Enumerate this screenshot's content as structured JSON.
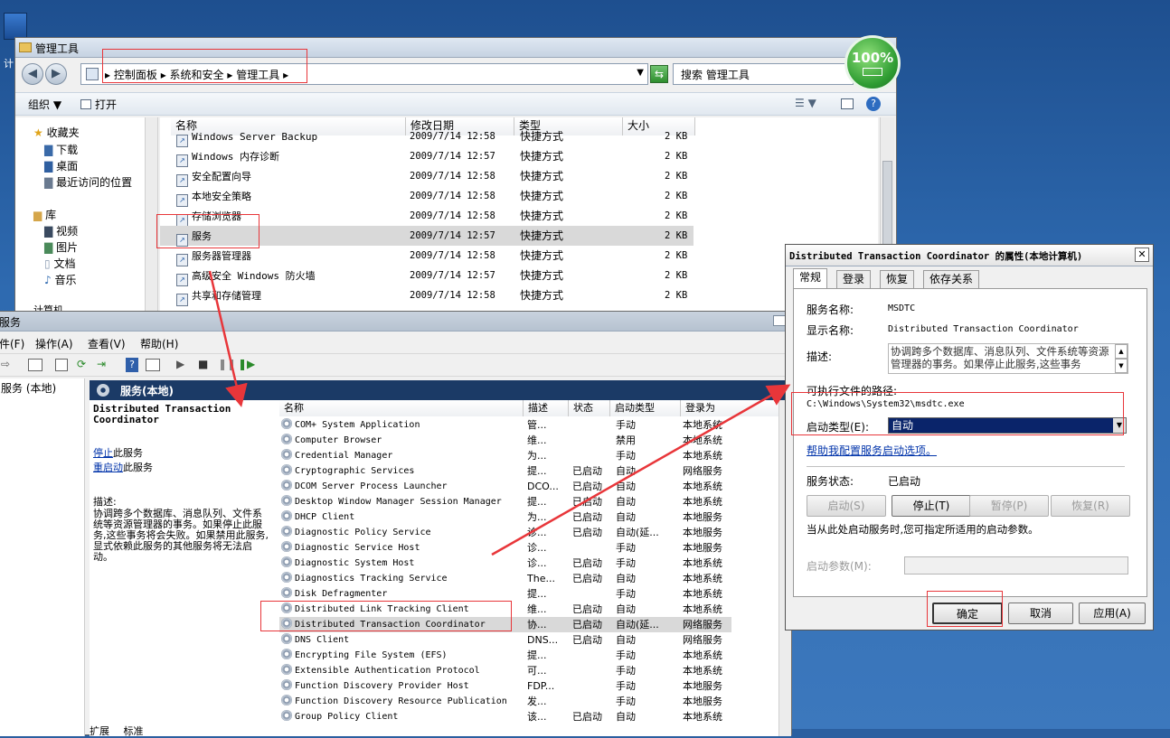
{
  "colors": {
    "red_annotation": "#e8363a",
    "title_dark": "#1b3a66",
    "selection": "#0a246a"
  },
  "desktop": {
    "icon_label": "计"
  },
  "explorer": {
    "title": "管理工具",
    "breadcrumb": [
      "控制面板",
      "系统和安全",
      "管理工具"
    ],
    "search_placeholder": "搜索 管理工具",
    "toolbar": {
      "organize": "组织",
      "open": "打开"
    },
    "nav": {
      "favorites": "收藏夹",
      "downloads": "下载",
      "desktop": "桌面",
      "recent": "最近访问的位置",
      "library": "库",
      "videos": "视频",
      "pictures": "图片",
      "documents": "文档",
      "music": "音乐",
      "computer": "计算机"
    },
    "columns": [
      "名称",
      "修改日期",
      "类型",
      "大小"
    ],
    "files": [
      {
        "name": "Windows Server Backup",
        "date": "2009/7/14 12:58",
        "type": "快捷方式",
        "size": "2 KB"
      },
      {
        "name": "Windows 内存诊断",
        "date": "2009/7/14 12:57",
        "type": "快捷方式",
        "size": "2 KB"
      },
      {
        "name": "安全配置向导",
        "date": "2009/7/14 12:58",
        "type": "快捷方式",
        "size": "2 KB"
      },
      {
        "name": "本地安全策略",
        "date": "2009/7/14 12:58",
        "type": "快捷方式",
        "size": "2 KB"
      },
      {
        "name": "存储浏览器",
        "date": "2009/7/14 12:58",
        "type": "快捷方式",
        "size": "2 KB"
      },
      {
        "name": "服务",
        "date": "2009/7/14 12:57",
        "type": "快捷方式",
        "size": "2 KB"
      },
      {
        "name": "服务器管理器",
        "date": "2009/7/14 12:58",
        "type": "快捷方式",
        "size": "2 KB"
      },
      {
        "name": "高级安全 Windows 防火墙",
        "date": "2009/7/14 12:57",
        "type": "快捷方式",
        "size": "2 KB"
      },
      {
        "name": "共享和存储管理",
        "date": "2009/7/14 12:58",
        "type": "快捷方式",
        "size": "2 KB"
      }
    ]
  },
  "badge": {
    "percent": "100%"
  },
  "services": {
    "title": "服务",
    "menu": [
      "件(F)",
      "操作(A)",
      "查看(V)",
      "帮助(H)"
    ],
    "tree_item": "服务 (本地)",
    "panel_title": "服务(本地)",
    "detail": {
      "name": "Distributed Transaction Coordinator",
      "stop_link": "停止",
      "stop_suffix": "此服务",
      "restart_link": "重启动",
      "restart_suffix": "此服务",
      "desc_label": "描述:",
      "desc": "协调跨多个数据库、消息队列、文件系统等资源管理器的事务。如果停止此服务,这些事务将会失败。如果禁用此服务,显式依赖此服务的其他服务将无法启动。"
    },
    "columns": [
      "名称",
      "描述",
      "状态",
      "启动类型",
      "登录为"
    ],
    "rows": [
      {
        "name": "COM+ System Application",
        "desc": "管...",
        "status": "",
        "startup": "手动",
        "logon": "本地系统"
      },
      {
        "name": "Computer Browser",
        "desc": "维...",
        "status": "",
        "startup": "禁用",
        "logon": "本地系统"
      },
      {
        "name": "Credential Manager",
        "desc": "为...",
        "status": "",
        "startup": "手动",
        "logon": "本地系统"
      },
      {
        "name": "Cryptographic Services",
        "desc": "提...",
        "status": "已启动",
        "startup": "自动",
        "logon": "网络服务"
      },
      {
        "name": "DCOM Server Process Launcher",
        "desc": "DCO...",
        "status": "已启动",
        "startup": "自动",
        "logon": "本地系统"
      },
      {
        "name": "Desktop Window Manager Session Manager",
        "desc": "提...",
        "status": "已启动",
        "startup": "自动",
        "logon": "本地系统"
      },
      {
        "name": "DHCP Client",
        "desc": "为...",
        "status": "已启动",
        "startup": "自动",
        "logon": "本地服务"
      },
      {
        "name": "Diagnostic Policy Service",
        "desc": "诊...",
        "status": "已启动",
        "startup": "自动(延...",
        "logon": "本地服务"
      },
      {
        "name": "Diagnostic Service Host",
        "desc": "诊...",
        "status": "",
        "startup": "手动",
        "logon": "本地服务"
      },
      {
        "name": "Diagnostic System Host",
        "desc": "诊...",
        "status": "已启动",
        "startup": "手动",
        "logon": "本地系统"
      },
      {
        "name": "Diagnostics Tracking Service",
        "desc": "The...",
        "status": "已启动",
        "startup": "自动",
        "logon": "本地系统"
      },
      {
        "name": "Disk Defragmenter",
        "desc": "提...",
        "status": "",
        "startup": "手动",
        "logon": "本地系统"
      },
      {
        "name": "Distributed Link Tracking Client",
        "desc": "维...",
        "status": "已启动",
        "startup": "自动",
        "logon": "本地系统"
      },
      {
        "name": "Distributed Transaction Coordinator",
        "desc": "协...",
        "status": "已启动",
        "startup": "自动(延...",
        "logon": "网络服务"
      },
      {
        "name": "DNS Client",
        "desc": "DNS...",
        "status": "已启动",
        "startup": "自动",
        "logon": "网络服务"
      },
      {
        "name": "Encrypting File System (EFS)",
        "desc": "提...",
        "status": "",
        "startup": "手动",
        "logon": "本地系统"
      },
      {
        "name": "Extensible Authentication Protocol",
        "desc": "可...",
        "status": "",
        "startup": "手动",
        "logon": "本地系统"
      },
      {
        "name": "Function Discovery Provider Host",
        "desc": "FDP...",
        "status": "",
        "startup": "手动",
        "logon": "本地服务"
      },
      {
        "name": "Function Discovery Resource Publication",
        "desc": "发...",
        "status": "",
        "startup": "手动",
        "logon": "本地服务"
      },
      {
        "name": "Group Policy Client",
        "desc": "该...",
        "status": "已启动",
        "startup": "自动",
        "logon": "本地系统"
      }
    ],
    "bottom_tabs": [
      "扩展",
      "标准"
    ]
  },
  "dialog": {
    "title": "Distributed Transaction Coordinator 的属性(本地计算机)",
    "tabs": [
      "常规",
      "登录",
      "恢复",
      "依存关系"
    ],
    "service_name_label": "服务名称:",
    "service_name": "MSDTC",
    "display_name_label": "显示名称:",
    "display_name": "Distributed Transaction Coordinator",
    "desc_label": "描述:",
    "desc": "协调跨多个数据库、消息队列、文件系统等资源管理器的事务。如果停止此服务,这些事务",
    "path_label": "可执行文件的路径:",
    "path": "C:\\Windows\\System32\\msdtc.exe",
    "startup_label": "启动类型(E):",
    "startup_value": "自动",
    "help_link": "帮助我配置服务启动选项。",
    "status_label": "服务状态:",
    "status_value": "已启动",
    "btn_start": "启动(S)",
    "btn_stop": "停止(T)",
    "btn_pause": "暂停(P)",
    "btn_resume": "恢复(R)",
    "hint": "当从此处启动服务时,您可指定所适用的启动参数。",
    "params_label": "启动参数(M):",
    "ok": "确定",
    "cancel": "取消",
    "apply": "应用(A)"
  }
}
